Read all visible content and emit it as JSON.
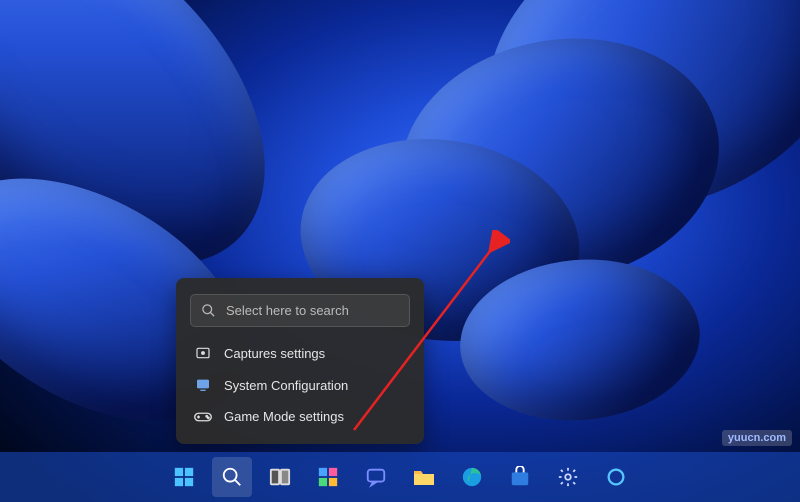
{
  "search_popup": {
    "placeholder": "Select here to search",
    "items": [
      {
        "label": "Captures settings"
      },
      {
        "label": "System Configuration"
      },
      {
        "label": "Game Mode settings"
      }
    ]
  },
  "taskbar": {
    "items": [
      {
        "name": "start",
        "active": false
      },
      {
        "name": "search",
        "active": true
      },
      {
        "name": "task-view",
        "active": false
      },
      {
        "name": "widgets",
        "active": false
      },
      {
        "name": "chat",
        "active": false
      },
      {
        "name": "file-explorer",
        "active": false
      },
      {
        "name": "edge",
        "active": false
      },
      {
        "name": "store",
        "active": false
      },
      {
        "name": "settings",
        "active": false
      },
      {
        "name": "cortana",
        "active": false
      }
    ]
  },
  "watermark": "yuucn.com"
}
